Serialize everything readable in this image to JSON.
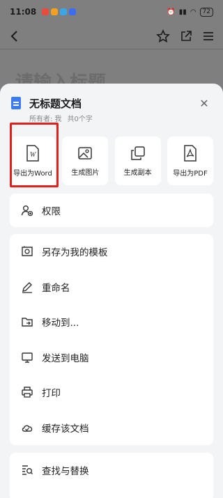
{
  "status_bar": {
    "time": "11:08",
    "battery": "72"
  },
  "background": {
    "title_placeholder": "请输入标题"
  },
  "sheet": {
    "doc_title": "无标题文档",
    "owner": "所有者: 我",
    "word_count": "共0个字",
    "actions": [
      {
        "label": "导出为Word",
        "icon": "word-doc-icon"
      },
      {
        "label": "生成图片",
        "icon": "image-icon"
      },
      {
        "label": "生成副本",
        "icon": "copy-icon"
      },
      {
        "label": "导出为PDF",
        "icon": "pdf-icon"
      }
    ],
    "permission": "权限",
    "menu": [
      {
        "label": "另存为我的模板",
        "icon": "template-icon"
      },
      {
        "label": "重命名",
        "icon": "pencil-icon"
      },
      {
        "label": "移动到...",
        "icon": "folder-move-icon"
      },
      {
        "label": "发送到电脑",
        "icon": "monitor-icon"
      },
      {
        "label": "打印",
        "icon": "printer-icon"
      },
      {
        "label": "缓存该文档",
        "icon": "cloud-check-icon"
      }
    ],
    "find_replace": "查找与替换"
  }
}
